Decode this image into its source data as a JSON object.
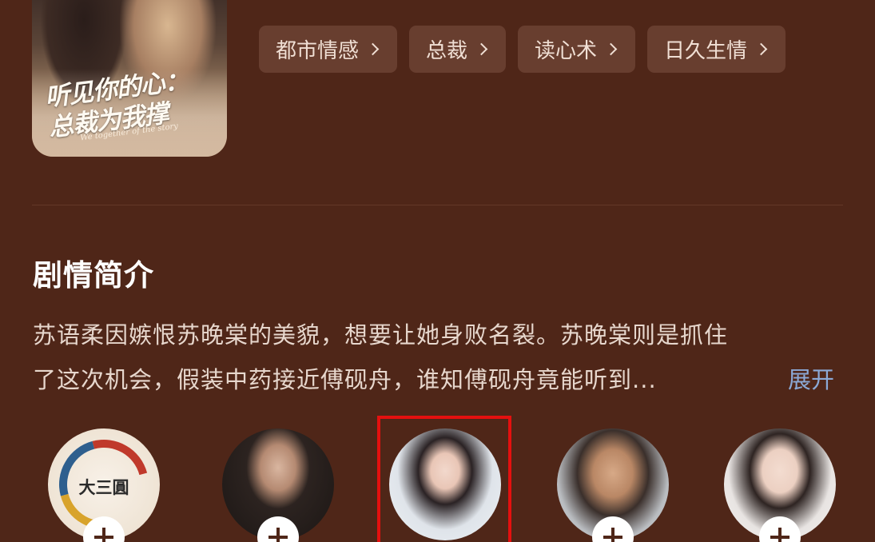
{
  "poster": {
    "title_line1": "听见你的心：",
    "title_line2": "总裁为我撑",
    "subtitle": "We together of the story"
  },
  "tags": [
    {
      "label": "都市情感"
    },
    {
      "label": "总裁"
    },
    {
      "label": "读心术"
    },
    {
      "label": "日久生情"
    }
  ],
  "synopsis": {
    "title": "剧情简介",
    "line1": "苏语柔因嫉恨苏晚棠的美貌，想要让她身败名裂。苏晚棠则是抓住",
    "line2": "了这次机会，假装中药接近傅砚舟，谁知傅砚舟竟能听到...",
    "expand_label": "展开"
  },
  "cast": {
    "logo_text": "大三圓",
    "highlight_color": "#e4100f"
  },
  "colors": {
    "background": "#4f2618",
    "tag_bg": "#683e2f",
    "link": "#8ba9d6"
  }
}
